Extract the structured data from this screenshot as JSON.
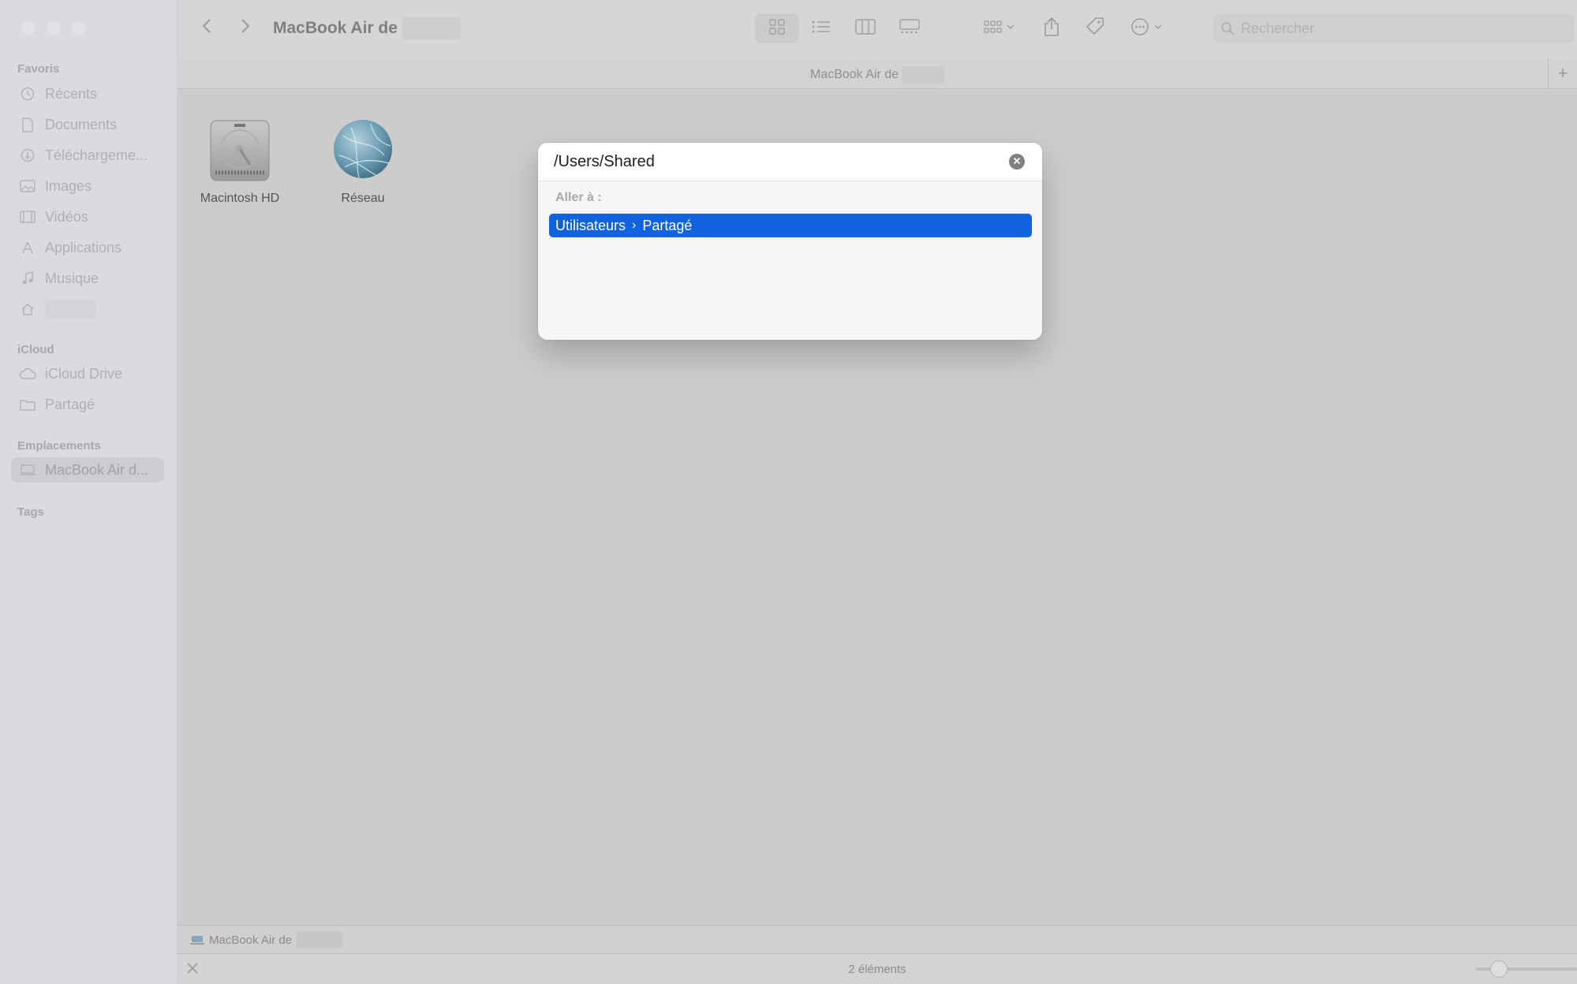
{
  "window": {
    "title": "MacBook Air de",
    "path_header": "MacBook Air de"
  },
  "sidebar": {
    "sections": {
      "favorites": "Favoris",
      "icloud": "iCloud",
      "locations": "Emplacements",
      "tags": "Tags"
    },
    "favorites": [
      {
        "label": "Récents",
        "icon": "clock-icon"
      },
      {
        "label": "Documents",
        "icon": "document-icon"
      },
      {
        "label": "Téléchargeme...",
        "icon": "download-icon"
      },
      {
        "label": "Images",
        "icon": "photo-icon"
      },
      {
        "label": "Vidéos",
        "icon": "film-icon"
      },
      {
        "label": "Applications",
        "icon": "applications-icon"
      },
      {
        "label": "Musique",
        "icon": "music-icon"
      },
      {
        "label": "",
        "icon": "home-icon"
      }
    ],
    "icloud": [
      {
        "label": "iCloud Drive",
        "icon": "cloud-icon"
      },
      {
        "label": "Partagé",
        "icon": "shared-folder-icon"
      }
    ],
    "locations": [
      {
        "label": "MacBook Air d...",
        "icon": "laptop-icon"
      }
    ]
  },
  "toolbar": {
    "search_placeholder": "Rechercher"
  },
  "content": {
    "items": [
      {
        "name": "Macintosh HD",
        "icon": "hard-drive-icon"
      },
      {
        "name": "Réseau",
        "icon": "network-globe-icon"
      }
    ]
  },
  "pathbar": {
    "label": "MacBook Air de"
  },
  "status": {
    "count": "2 éléments"
  },
  "dialog": {
    "input_value": "/Users/Shared",
    "section_label": "Aller à :",
    "result": {
      "part1": "Utilisateurs",
      "separator": "›",
      "part2": "Partagé"
    }
  },
  "colors": {
    "accent": "#1162de"
  }
}
